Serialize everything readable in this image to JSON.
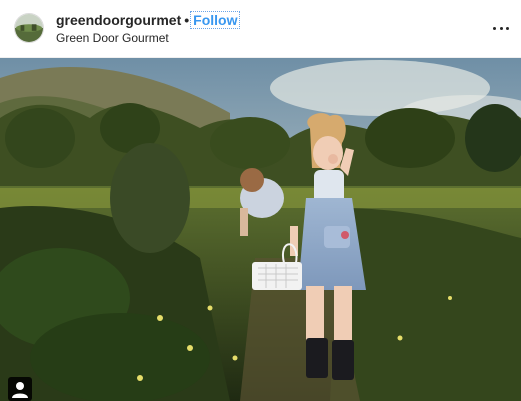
{
  "post": {
    "username": "greendoorgourmet",
    "separator": "•",
    "follow_label": "Follow",
    "location": "Green Door Gourmet"
  },
  "icons": {
    "avatar": "profile-avatar",
    "more": "more-options-icon",
    "tagged": "tagged-people-icon"
  },
  "colors": {
    "accent": "#3897f0",
    "text": "#262626"
  }
}
